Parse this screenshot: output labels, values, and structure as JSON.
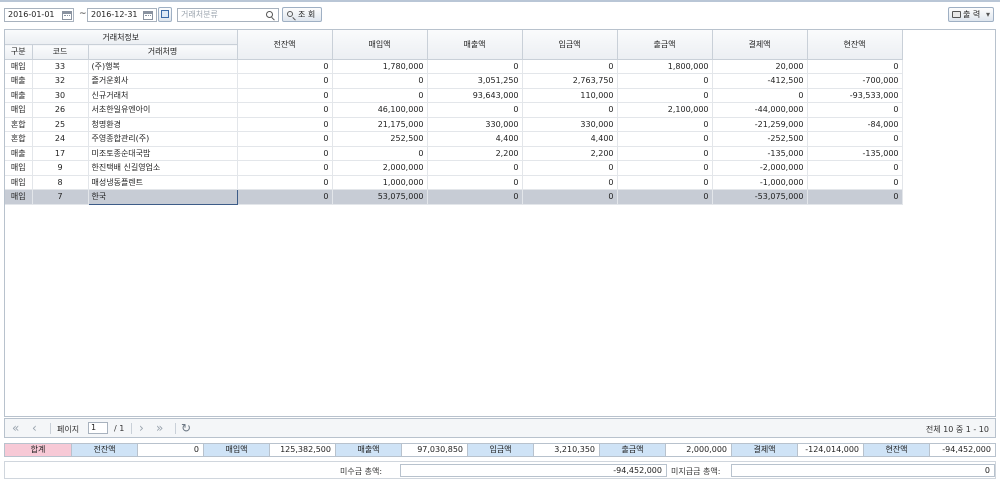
{
  "toolbar": {
    "date_from": "2016-01-01",
    "date_sep": "~",
    "date_to": "2016-12-31",
    "search_placeholder": "거래처분류",
    "search_button": "조 회",
    "print_button": "출 력"
  },
  "grid": {
    "group_header": "거래처정보",
    "columns": {
      "type": "구분",
      "code": "코드",
      "name": "거래처명",
      "prev_balance": "전잔액",
      "purchase": "매입액",
      "sales": "매출액",
      "deposit": "입금액",
      "withdrawal": "출금액",
      "settlement": "결제액",
      "balance": "현잔액"
    },
    "rows": [
      {
        "type": "매입",
        "code": "33",
        "name": "(주)행복",
        "prev": "0",
        "purchase": "1,780,000",
        "sales": "0",
        "deposit": "0",
        "withdrawal": "1,800,000",
        "settlement": "20,000",
        "balance": "0"
      },
      {
        "type": "매출",
        "code": "32",
        "name": "즐거운회사",
        "prev": "0",
        "purchase": "0",
        "sales": "3,051,250",
        "deposit": "2,763,750",
        "withdrawal": "0",
        "settlement": "-412,500",
        "balance": "-700,000"
      },
      {
        "type": "매출",
        "code": "30",
        "name": "신규거래처",
        "prev": "0",
        "purchase": "0",
        "sales": "93,643,000",
        "deposit": "110,000",
        "withdrawal": "0",
        "settlement": "0",
        "balance": "-93,533,000"
      },
      {
        "type": "매입",
        "code": "26",
        "name": "서초한일유엔아이",
        "prev": "0",
        "purchase": "46,100,000",
        "sales": "0",
        "deposit": "0",
        "withdrawal": "2,100,000",
        "settlement": "-44,000,000",
        "balance": "0"
      },
      {
        "type": "혼합",
        "code": "25",
        "name": "청명환경",
        "prev": "0",
        "purchase": "21,175,000",
        "sales": "330,000",
        "deposit": "330,000",
        "withdrawal": "0",
        "settlement": "-21,259,000",
        "balance": "-84,000"
      },
      {
        "type": "혼합",
        "code": "24",
        "name": "주영종합관리(주)",
        "prev": "0",
        "purchase": "252,500",
        "sales": "4,400",
        "deposit": "4,400",
        "withdrawal": "0",
        "settlement": "-252,500",
        "balance": "0"
      },
      {
        "type": "매출",
        "code": "17",
        "name": "미조토종순대국밥",
        "prev": "0",
        "purchase": "0",
        "sales": "2,200",
        "deposit": "2,200",
        "withdrawal": "0",
        "settlement": "-135,000",
        "balance": "-135,000"
      },
      {
        "type": "매입",
        "code": "9",
        "name": "한진택배 신길영업소",
        "prev": "0",
        "purchase": "2,000,000",
        "sales": "0",
        "deposit": "0",
        "withdrawal": "0",
        "settlement": "-2,000,000",
        "balance": "0"
      },
      {
        "type": "매입",
        "code": "8",
        "name": "매성냉동플렌트",
        "prev": "0",
        "purchase": "1,000,000",
        "sales": "0",
        "deposit": "0",
        "withdrawal": "0",
        "settlement": "-1,000,000",
        "balance": "0"
      },
      {
        "type": "매입",
        "code": "7",
        "name": "한국",
        "prev": "0",
        "purchase": "53,075,000",
        "sales": "0",
        "deposit": "0",
        "withdrawal": "0",
        "settlement": "-53,075,000",
        "balance": "0"
      }
    ]
  },
  "pager": {
    "page_label": "페이지",
    "page_value": "1",
    "page_total": "/ 1",
    "summary": "전체 10 중 1 - 10"
  },
  "totals": {
    "label": "합계",
    "prev_label": "전잔액",
    "prev_value": "0",
    "purchase_label": "매입액",
    "purchase_value": "125,382,500",
    "sales_label": "매출액",
    "sales_value": "97,030,850",
    "deposit_label": "입금액",
    "deposit_value": "3,210,350",
    "withdrawal_label": "출금액",
    "withdrawal_value": "2,000,000",
    "settlement_label": "결제액",
    "settlement_value": "-124,014,000",
    "balance_label": "현잔액",
    "balance_value": "-94,452,000"
  },
  "bottom": {
    "receivable_label": "미수금 총액:",
    "receivable_value": "-94,452,000",
    "payable_label": "미지급금 총액:",
    "payable_value": "0"
  }
}
